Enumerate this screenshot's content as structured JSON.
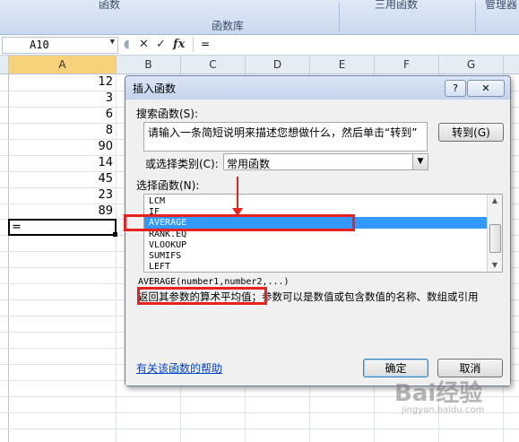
{
  "ribbon": {
    "group_function": "函数",
    "group_library": "函数库",
    "group_defined": "三用函数",
    "group_mgr": "管理器"
  },
  "formula_bar": {
    "name_box": "A10",
    "cancel_icon": "✕",
    "enter_icon": "✓",
    "fx_icon": "fx",
    "content": "="
  },
  "grid": {
    "columns": [
      "A",
      "B",
      "C",
      "D",
      "E",
      "F",
      "G"
    ],
    "values": [
      "12",
      "3",
      "6",
      "8",
      "90",
      "14",
      "45",
      "23",
      "89"
    ],
    "active_cell_content": "="
  },
  "dialog": {
    "title": "插入函数",
    "help_button": "?",
    "close_button": "✕",
    "search_label": "搜索函数(S):",
    "search_text": "请输入一条简短说明来描述您想做什么，然后单击“转到”",
    "go_button": "转到(G)",
    "category_label": "或选择类别(C):",
    "category_value": "常用函数",
    "select_label": "选择函数(N):",
    "functions": [
      "LCM",
      "IF",
      "AVERAGE",
      "RANK.EQ",
      "VLOOKUP",
      "SUMIFS",
      "LEFT"
    ],
    "selected_function": "AVERAGE",
    "syntax": "AVERAGE(number1,number2,...)",
    "description": "返回其参数的算术平均值；参数可以是数值或包含数值的名称、数组或引用",
    "help_link": "有关该函数的帮助",
    "ok_button": "确定",
    "cancel_button": "取消"
  },
  "watermark": {
    "text": "Bai经验",
    "sub": "jingyan.baidu.com"
  },
  "colors": {
    "selection": "#3399ff",
    "annotation": "#e8231f",
    "link": "#0044cc"
  }
}
